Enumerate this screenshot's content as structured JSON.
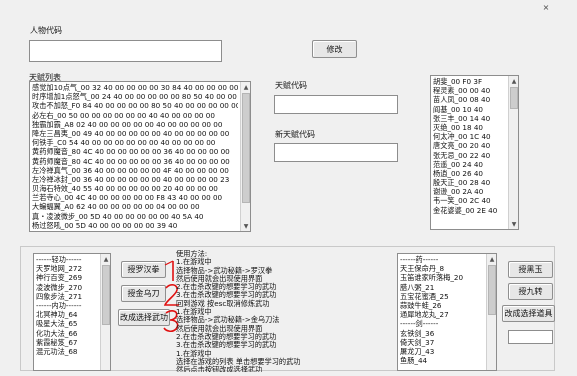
{
  "window": {
    "close_symbol": "×"
  },
  "top": {
    "char_code_label": "人物代码",
    "edit_button": "修改"
  },
  "talent": {
    "list_label": "天赋列表",
    "items": [
      "感觉加10点气_00 32 40 00 00 00 00 30 84 40 00 00 00 00",
      "时序增加1点怒气_00 24 40 00 00 00 00 00 80 50 40 00 00 00",
      "攻击不加怒_F0 84 40 00 00 00 00 80 50 40 00 00 00 00 00",
      "必左右_00 50 00 00 00 00 00 00 40 40 00 00 00 00",
      "独霸加霸_A8 02 40 00 00 00 00 00 40 00 00 00 00 00",
      "降左三昌夷_00 49 40 00 00 00 00 00 40 00 00 00 00 00",
      "何铁手_C0 54 40 00 00 00 00 00 00 40 00 00 00 00",
      "黄药师魔音_80 4C 40 00 00 00 00 00 36 40 00 00 00 00",
      "黄药师魔音_80 4C 40 00 00 00 00 00 36 40 00 00 00 00",
      "左冷禅真气_00 36 40 00 00 00 00 00 4F 40 00 00 00 00",
      "左冷禅冰封_00 36 40 00 00 00 00 00 40 00 00 00 00 23",
      "贝海石特效_40 55 40 00 00 00 00 00 20 40 00 00 00",
      "兰若寺心_00 4C 40 00 00 00 00 00 F8 43 40 00 00 00",
      "大蝙蝠翼_A0 62 40 00 00 00 00 00 04 00 00 00",
      "真・凌波微步_00 5D 40 00 00 00 00 00 40 5A 40",
      "杨过怒吼_00 5D 40 00 00 00 00 00 39 40"
    ],
    "code_label": "天赋代码",
    "new_code_label": "新天赋代码"
  },
  "right_list": {
    "items": [
      "胡斐_00 F0 3F",
      "程灵素_00 00 40",
      "苗人凤_00 08 40",
      "阎基_00 10 40",
      "张三丰_00 14 40",
      "灭绝_00 18 40",
      "何太冲_00 1C 40",
      "唐文亮_00 20 40",
      "张无忌_00 22 40",
      "范遥_00 24 40",
      "杨逍_00 26 40",
      "殷天正_00 28 40",
      "谢逊_00 2A 40",
      "韦一笑_00 2C 40",
      "金花婆婆_00 2E 40"
    ]
  },
  "bottom": {
    "skills_list": [
      "------轻功------",
      "天罗地网_272",
      "神行百变_269",
      "凌波微步_270",
      "四象步法_271",
      "------内功------",
      "北冥神功_64",
      "吸星大法_65",
      "化功大法_66",
      "紫霞秘笈_67",
      "混元功法_68"
    ],
    "btn_revenge": "授罗汉拳",
    "btn_golden": "授金乌刀",
    "btn_select": "改成选择武功",
    "instructions": [
      "使用方法:",
      "1.在游戏中",
      "选择物品->武功秘籍->罗汉拳",
      "然后使用就会出现使用界面",
      "2.在击杀改键的想要学习的武功",
      "3.在击杀改键的想要学习的武功",
      "回到游戏 按esc取消修炼武功",
      "1.在游戏中",
      "选择物品->武功秘籍->金乌刀法",
      "然后使用就会出现使用界面",
      "2.在击杀改键的想要学习的武功",
      "3.在击杀改键的想要学习的武功",
      "1.在游戏中",
      "选择在游戏的列表 单击想要学习的武功",
      "然后点击按钮改成选择武功",
      "回到游戏 选择人物并点击回车修炼",
      "查看人物装修界面"
    ],
    "items_list": [
      "------药------",
      "天王保命丹_8",
      "玉笛谁家听落梅_20",
      "腊八粥_21",
      "五宝花蜜酒_25",
      "蒜豉牛蛙_26",
      "通犀地龙丸_27",
      "------剑------",
      "玄铁剑_36",
      "倚天剑_37",
      "屠龙刀_43",
      "鱼肠_44"
    ],
    "btn_black_jade": "授黑玉",
    "btn_nine_turns": "授九转",
    "btn_select_item": "改成选择道具"
  }
}
